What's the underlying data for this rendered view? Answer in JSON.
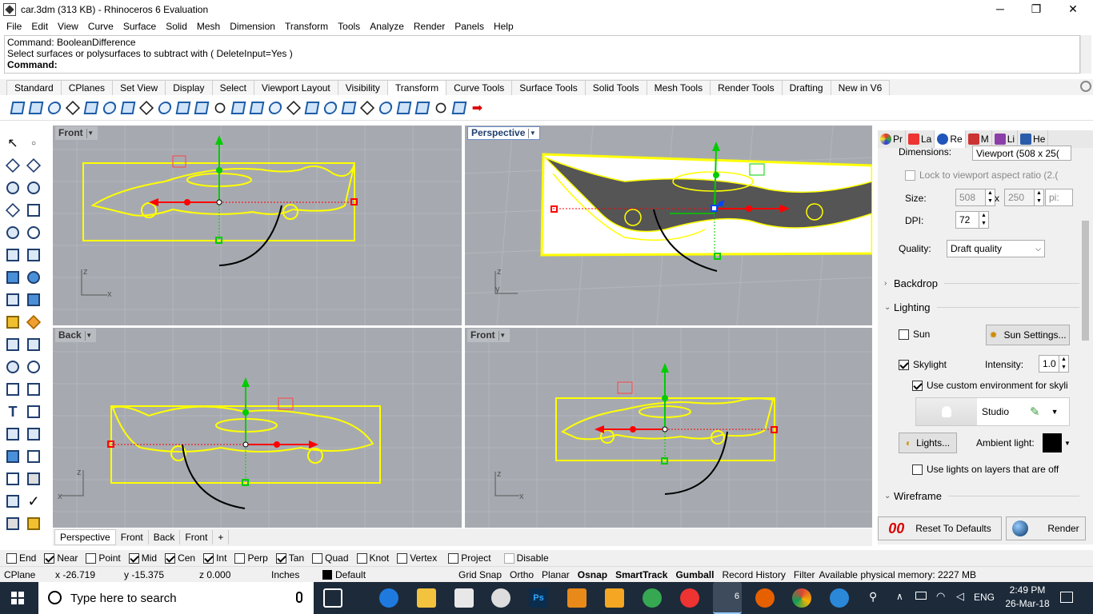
{
  "window": {
    "title": "car.3dm (313 KB) - Rhinoceros 6 Evaluation",
    "minimize": "─",
    "restore": "❐",
    "close": "✕"
  },
  "menu": [
    "File",
    "Edit",
    "View",
    "Curve",
    "Surface",
    "Solid",
    "Mesh",
    "Dimension",
    "Transform",
    "Tools",
    "Analyze",
    "Render",
    "Panels",
    "Help"
  ],
  "command": {
    "line1": "Command: BooleanDifference",
    "line2": "Select surfaces or polysurfaces to subtract with ( DeleteInput=Yes )",
    "prompt": "Command:"
  },
  "tabs": [
    "Standard",
    "CPlanes",
    "Set View",
    "Display",
    "Select",
    "Viewport Layout",
    "Visibility",
    "Transform",
    "Curve Tools",
    "Surface Tools",
    "Solid Tools",
    "Mesh Tools",
    "Render Tools",
    "Drafting",
    "New in V6"
  ],
  "active_tab": "Transform",
  "viewports": {
    "top_left": "Front",
    "top_right": "Perspective",
    "bottom_left": "Back",
    "bottom_right": "Front"
  },
  "axes": {
    "x": "x",
    "y": "y",
    "z": "z"
  },
  "viewport_tabs": [
    "Perspective",
    "Front",
    "Back",
    "Front"
  ],
  "viewport_tab_add": "+",
  "panel": {
    "tabs": [
      "Pr",
      "La",
      "Re",
      "M",
      "Li",
      "He"
    ],
    "dimensions_label": "Dimensions:",
    "dimensions_value": "Viewport (508 x 25(",
    "lock_label": "Lock to viewport aspect ratio (2.(",
    "size_label": "Size:",
    "size_w": "508",
    "size_x": "x",
    "size_h": "250",
    "size_unit": "pi:",
    "dpi_label": "DPI:",
    "dpi_value": "72",
    "quality_label": "Quality:",
    "quality_value": "Draft quality",
    "backdrop": "Backdrop",
    "lighting": "Lighting",
    "sun_label": "Sun",
    "sun_settings": "Sun Settings...",
    "skylight_label": "Skylight",
    "intensity_label": "Intensity:",
    "intensity_value": "1.0",
    "custom_env_label": "Use custom environment for skyli",
    "studio_label": "Studio",
    "lights_button": "Lights...",
    "ambient_label": "Ambient light:",
    "lights_off_label": "Use lights on layers that are off",
    "wireframe": "Wireframe",
    "reset_button": "Reset To Defaults",
    "render_button": "Render"
  },
  "osnap": [
    {
      "label": "End",
      "checked": false
    },
    {
      "label": "Near",
      "checked": true
    },
    {
      "label": "Point",
      "checked": false
    },
    {
      "label": "Mid",
      "checked": true
    },
    {
      "label": "Cen",
      "checked": true
    },
    {
      "label": "Int",
      "checked": true
    },
    {
      "label": "Perp",
      "checked": false
    },
    {
      "label": "Tan",
      "checked": true
    },
    {
      "label": "Quad",
      "checked": false
    },
    {
      "label": "Knot",
      "checked": false
    },
    {
      "label": "Vertex",
      "checked": false
    },
    {
      "label": "Project",
      "checked": false
    },
    {
      "label": "Disable",
      "checked": false
    }
  ],
  "status": {
    "cplane": "CPlane",
    "x": "x -26.719",
    "y": "y -15.375",
    "z": "z 0.000",
    "units": "Inches",
    "layer": "Default",
    "grid_snap": "Grid Snap",
    "ortho": "Ortho",
    "planar": "Planar",
    "osnap": "Osnap",
    "smarttrack": "SmartTrack",
    "gumball": "Gumball",
    "record_history": "Record History",
    "filter": "Filter",
    "memory": "Available physical memory: 2227 MB"
  },
  "taskbar": {
    "search_placeholder": "Type here to search",
    "time": "2:49 PM",
    "date": "26-Mar-18",
    "lang": "ENG",
    "ps": "Ps",
    "rhino": "6"
  },
  "colors": {
    "curve": "#ffff00",
    "viewport_bg": "#a6aab0",
    "gumball_red": "#ff0000",
    "gumball_green": "#00cc00",
    "taskbar": "#1c2a3a"
  }
}
